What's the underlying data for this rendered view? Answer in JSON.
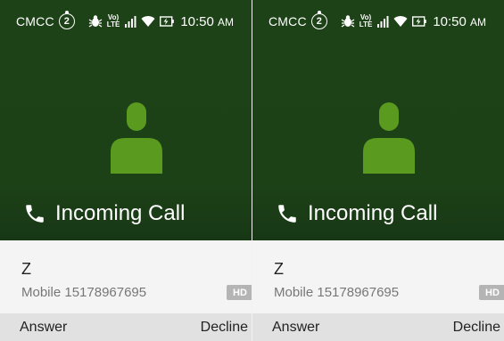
{
  "status_bar": {
    "carrier": "CMCC",
    "sim_slot": "2",
    "volte_top": "Vo)",
    "volte_bottom": "LTE",
    "time": "10:50",
    "time_suffix": "AM",
    "icons": [
      "sim-icon",
      "bug-icon",
      "volte-icon",
      "signal-icon",
      "wifi-icon",
      "battery-charging-icon"
    ]
  },
  "call": {
    "label": "Incoming Call",
    "caller_name": "Z",
    "number_line": "Mobile 15178967695",
    "hd_badge": "HD"
  },
  "actions": {
    "answer_label": "Answer",
    "decline_label": "Decline"
  },
  "colors": {
    "header_bg": "#1e4217",
    "avatar": "#5a9a1e",
    "actions_bg": "#e1e1e1",
    "hd_badge": "#b4b4b4"
  }
}
